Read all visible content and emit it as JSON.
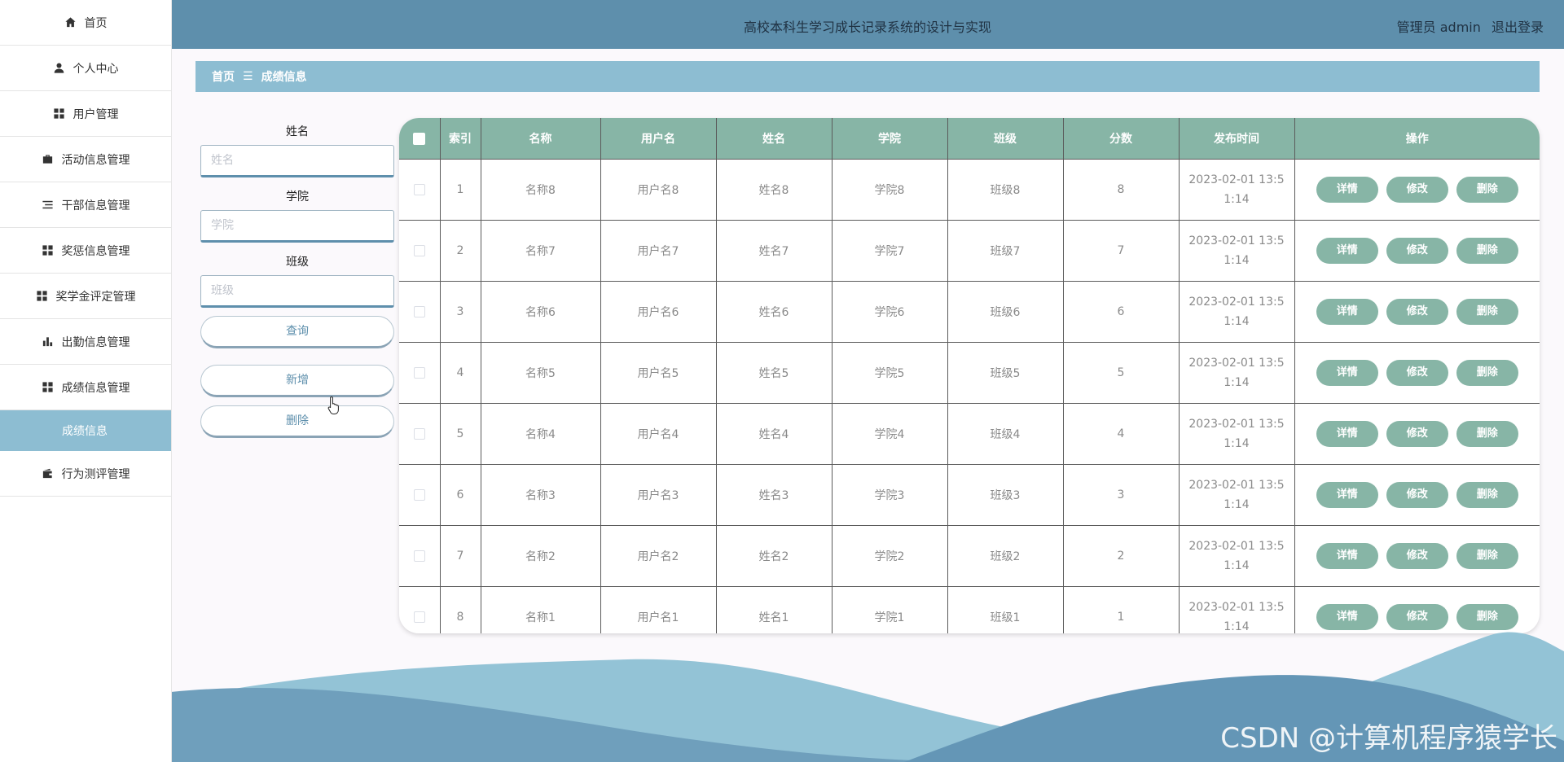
{
  "sidebar": {
    "items": [
      {
        "label": "首页",
        "icon": "home-icon"
      },
      {
        "label": "个人中心",
        "icon": "person-icon"
      },
      {
        "label": "用户管理",
        "icon": "grid-icon"
      },
      {
        "label": "活动信息管理",
        "icon": "briefcase-icon"
      },
      {
        "label": "干部信息管理",
        "icon": "list-icon"
      },
      {
        "label": "奖惩信息管理",
        "icon": "grid-icon"
      },
      {
        "label": "奖学金评定管理",
        "icon": "grid-icon"
      },
      {
        "label": "出勤信息管理",
        "icon": "bar-chart-icon"
      },
      {
        "label": "成绩信息管理",
        "icon": "grid-icon"
      }
    ],
    "sub_item": {
      "label": "成绩信息"
    },
    "last_item": {
      "label": "行为测评管理",
      "icon": "wallet-icon"
    }
  },
  "header": {
    "title": "高校本科生学习成长记录系统的设计与实现",
    "user_label": "管理员 admin",
    "logout_label": "退出登录",
    "bg_color": "#5e8fac"
  },
  "breadcrumb": {
    "home": "首页",
    "separator": "☰",
    "current": "成绩信息"
  },
  "search": {
    "name_label": "姓名",
    "name_placeholder": "姓名",
    "college_label": "学院",
    "college_placeholder": "学院",
    "class_label": "班级",
    "class_placeholder": "班级",
    "query_button": "查询",
    "add_button": "新增",
    "delete_button": "删除"
  },
  "table": {
    "headers": [
      "索引",
      "名称",
      "用户名",
      "姓名",
      "学院",
      "班级",
      "分数",
      "发布时间",
      "操作"
    ],
    "header_color": "#87b5a6",
    "actions": {
      "detail": "详情",
      "edit": "修改",
      "delete": "删除"
    },
    "rows": [
      {
        "index": "1",
        "name": "名称8",
        "username": "用户名8",
        "person": "姓名8",
        "college": "学院8",
        "class": "班级8",
        "score": "8",
        "time": "2023-02-01 13:51:14"
      },
      {
        "index": "2",
        "name": "名称7",
        "username": "用户名7",
        "person": "姓名7",
        "college": "学院7",
        "class": "班级7",
        "score": "7",
        "time": "2023-02-01 13:51:14"
      },
      {
        "index": "3",
        "name": "名称6",
        "username": "用户名6",
        "person": "姓名6",
        "college": "学院6",
        "class": "班级6",
        "score": "6",
        "time": "2023-02-01 13:51:14"
      },
      {
        "index": "4",
        "name": "名称5",
        "username": "用户名5",
        "person": "姓名5",
        "college": "学院5",
        "class": "班级5",
        "score": "5",
        "time": "2023-02-01 13:51:14"
      },
      {
        "index": "5",
        "name": "名称4",
        "username": "用户名4",
        "person": "姓名4",
        "college": "学院4",
        "class": "班级4",
        "score": "4",
        "time": "2023-02-01 13:51:14"
      },
      {
        "index": "6",
        "name": "名称3",
        "username": "用户名3",
        "person": "姓名3",
        "college": "学院3",
        "class": "班级3",
        "score": "3",
        "time": "2023-02-01 13:51:14"
      },
      {
        "index": "7",
        "name": "名称2",
        "username": "用户名2",
        "person": "姓名2",
        "college": "学院2",
        "class": "班级2",
        "score": "2",
        "time": "2023-02-01 13:51:14"
      },
      {
        "index": "8",
        "name": "名称1",
        "username": "用户名1",
        "person": "姓名1",
        "college": "学院1",
        "class": "班级1",
        "score": "1",
        "time": "2023-02-01 13:51:14"
      }
    ]
  },
  "watermark": "CSDN @计算机程序猿学长"
}
